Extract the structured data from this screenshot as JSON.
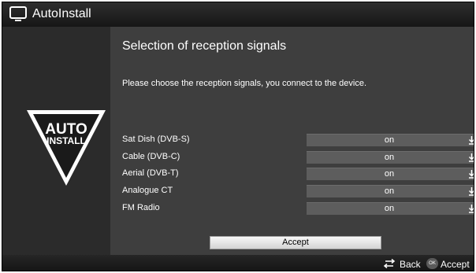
{
  "header": {
    "title": "AutoInstall",
    "icon": "tv-icon"
  },
  "logo": {
    "line1": "AUTO",
    "line2": "INSTALL",
    "icon": "autoinstall-logo"
  },
  "main": {
    "title": "Selection of reception signals",
    "instructions": "Please choose the reception signals, you connect to the device.",
    "rows": [
      {
        "label": "Sat Dish (DVB-S)",
        "value": "on"
      },
      {
        "label": "Cable (DVB-C)",
        "value": "on"
      },
      {
        "label": "Aerial (DVB-T)",
        "value": "on"
      },
      {
        "label": "Analogue CT",
        "value": "on"
      },
      {
        "label": "FM Radio",
        "value": "on"
      }
    ],
    "accept_button": "Accept"
  },
  "footer": {
    "back_label": "Back",
    "ok_icon_text": "OK",
    "accept_label": "Accept"
  }
}
